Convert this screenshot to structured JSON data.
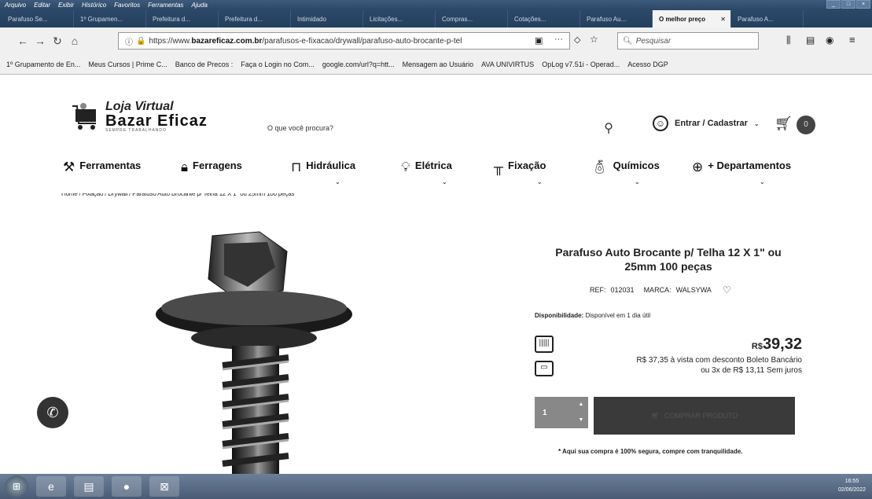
{
  "menubar": [
    "Arquivo",
    "Editar",
    "Exibir",
    "Histórico",
    "Favoritos",
    "Ferramentas",
    "Ajuda"
  ],
  "tabs": [
    {
      "label": "Parafuso Se..."
    },
    {
      "label": "1º Grupamen..."
    },
    {
      "label": "Prefeitura d..."
    },
    {
      "label": "Prefeitura d..."
    },
    {
      "label": "Intimidado"
    },
    {
      "label": "Licitações..."
    },
    {
      "label": "Compras..."
    },
    {
      "label": "Cotações..."
    },
    {
      "label": "Parafuso Au..."
    },
    {
      "label": "O melhor preço"
    },
    {
      "label": "Parafuso A..."
    }
  ],
  "browser": {
    "url_prefix": "https://www.",
    "url_domain": "bazareficaz.com.br",
    "url_path": "/parafusos-e-fixacao/drywall/parafuso-auto-brocante-p-tel",
    "search_placeholder": "Pesquisar"
  },
  "bookmarks": [
    "1º Grupamento de En...",
    "Meus Cursos | Prime C...",
    "Banco de Precos :",
    "Faça o Login no Com...",
    "google.com/url?q=htt...",
    "Mensagem ao Usuário",
    "AVA UNIVIRTUS",
    "OpLog v7.51i - Operad...",
    "Acesso DGP"
  ],
  "site": {
    "logo_line1": "Loja Virtual",
    "logo_line2": "Bazar Eficaz",
    "logo_line3": "SEMPRE TRABALHANDO",
    "search_placeholder": "O que você procura?",
    "login_label": "Entrar / Cadastrar",
    "cart_count": "0"
  },
  "categories": [
    {
      "label": "Ferramentas",
      "icon": "hammer-icon"
    },
    {
      "label": "Ferragens",
      "icon": "lock-icon"
    },
    {
      "label": "Hidráulica",
      "icon": "faucet-icon"
    },
    {
      "label": "Elétrica",
      "icon": "bulb-icon"
    },
    {
      "label": "Fixação",
      "icon": "screw-icon"
    },
    {
      "label": "Químicos",
      "icon": "spray-icon"
    },
    {
      "label": "+ Departamentos",
      "icon": "plus-circle-icon"
    }
  ],
  "breadcrumb": "Home / Fixação / Drywall / Parafuso Auto Brocante p/ Telha 12 X 1\" ou 25mm 100 peças",
  "product": {
    "title": "Parafuso Auto Brocante p/ Telha 12 X 1\" ou 25mm 100 peças",
    "ref_label": "REF:",
    "ref": "012031",
    "brand_label": "MARCA:",
    "brand": "WALSYWA",
    "availability_label": "Disponibilidade:",
    "availability": "Disponível em 1 dia útil",
    "currency": "R$",
    "price": "39,32",
    "boleto": "R$ 37,35 à vista com desconto Boleto Bancário",
    "installments": "ou 3x de R$ 13,11 Sem juros",
    "quantity": "1",
    "buy_label": "COMPRAR PRODUTO",
    "secure_text": "* Aqui sua compra é 100% segura, compre com tranquilidade."
  },
  "taskbar": {
    "time": "16:55",
    "date": "02/06/2022"
  }
}
